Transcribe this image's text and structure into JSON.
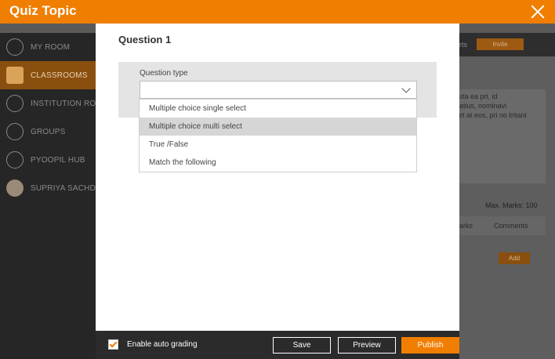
{
  "header": {
    "title": "Quiz Topic"
  },
  "sidebar": {
    "items": [
      {
        "label": "MY ROOM",
        "icon": "person-icon"
      },
      {
        "label": "CLASSROOMS",
        "icon": "classroom-icon",
        "active": true
      },
      {
        "label": "INSTITUTION ROO",
        "icon": "institution-icon"
      },
      {
        "label": "GROUPS",
        "icon": "groups-icon"
      },
      {
        "label": "PYOOPIL HUB",
        "icon": "hub-icon"
      },
      {
        "label": "SUPRIYA SACHDE",
        "icon": "avatar-icon"
      }
    ]
  },
  "background": {
    "nav_fragment": "rts",
    "invite_label": "Invite",
    "text_lines": [
      "oluta ea pri, id",
      "eratius, nominavi",
      "diet at eos, pri no tritani"
    ],
    "max_marks": "Max. Marks: 100",
    "tabs": [
      "arks",
      "Comments"
    ],
    "add_label": "Add"
  },
  "modal": {
    "question_title": "Question 1",
    "question_type_label": "Question type",
    "select_value": "",
    "options": [
      "Multiple choice single select",
      "Multiple choice multi select",
      "True /False",
      "Match the following"
    ],
    "highlighted_option_index": 1
  },
  "footer": {
    "auto_grading_label": "Enable auto grading",
    "auto_grading_checked": true,
    "save_label": "Save",
    "preview_label": "Preview",
    "publish_label": "Publish"
  },
  "colors": {
    "accent": "#f07e00",
    "footer_bg": "#2b2b2b",
    "highlight": "#d6d6d6"
  }
}
